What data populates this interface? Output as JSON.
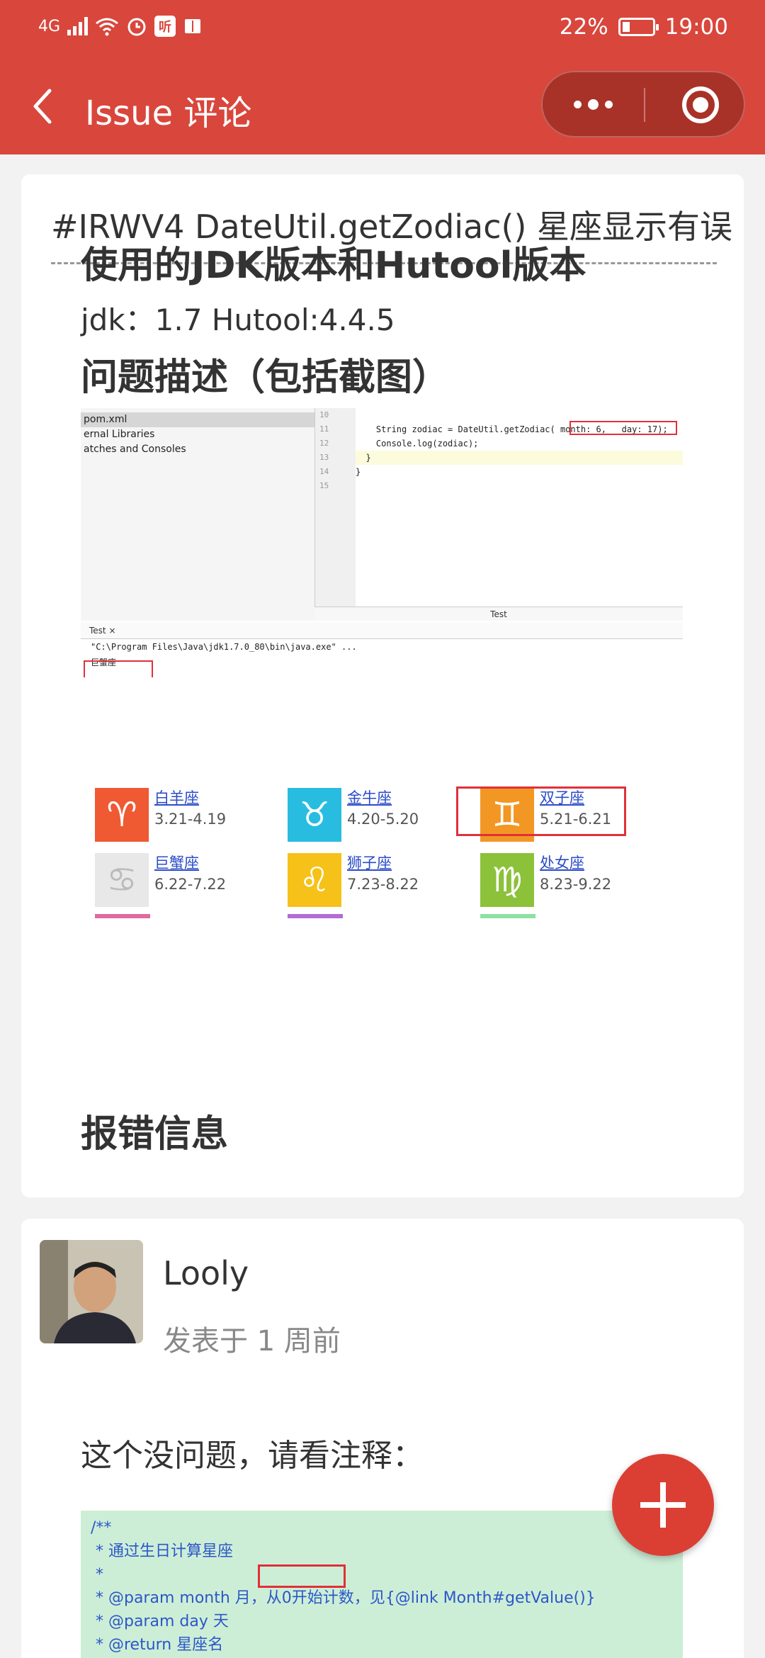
{
  "statusbar": {
    "network": "4G",
    "app_badge": "听",
    "battery": "22%",
    "time": "19:00"
  },
  "nav": {
    "title": "Issue 评论"
  },
  "issue": {
    "title": "#IRWV4 DateUtil.getZodiac() 星座显示有误",
    "sections": [
      {
        "heading": "使用的JDK版本和Hutool版本",
        "text": "jdk：1.7 Hutool:4.4.5"
      },
      {
        "heading": "问题描述（包括截图）"
      },
      {
        "heading": "报错信息"
      }
    ],
    "ide": {
      "tree": [
        "pom.xml",
        "ernal Libraries",
        "atches and Consoles"
      ],
      "line_numbers": [
        "10",
        "11",
        "12",
        "13",
        "14",
        "15"
      ],
      "code": [
        "",
        "    String zodiac = DateUtil.getZodiac( month: 6,   day: 17);",
        "    Console.log(zodiac);",
        "  }",
        "}",
        ""
      ],
      "bottom_tab": "Test",
      "console_tab": "Test ×",
      "console": [
        "\"C:\\Program Files\\Java\\jdk1.7.0_80\\bin\\java.exe\" ...",
        "巨蟹座"
      ]
    },
    "zodiac": [
      {
        "name": "白羊座",
        "dates": "3.21-4.19",
        "symbol": "♈",
        "color": "#ef5a33"
      },
      {
        "name": "金牛座",
        "dates": "4.20-5.20",
        "symbol": "♉",
        "color": "#28bde0"
      },
      {
        "name": "双子座",
        "dates": "5.21-6.21",
        "symbol": "♊",
        "color": "#f29724"
      },
      {
        "name": "巨蟹座",
        "dates": "6.22-7.22",
        "symbol": "♋",
        "color": "#e8e8e8"
      },
      {
        "name": "狮子座",
        "dates": "7.23-8.22",
        "symbol": "♌",
        "color": "#f6c219"
      },
      {
        "name": "处女座",
        "dates": "8.23-9.22",
        "symbol": "♍",
        "color": "#8cc13a"
      }
    ]
  },
  "comment": {
    "author": "Looly",
    "posted": "发表于 1 周前",
    "text": "这个没问题，请看注释：",
    "code": [
      "/**",
      " * 通过生日计算星座",
      " *",
      " * @param month 月，从0开始计数，见{@link Month#getValue()}",
      " * @param day 天",
      " * @return 星座名",
      " */"
    ]
  },
  "colors": {
    "header": "#d9463c",
    "fab": "#db3f34",
    "highlight_box": "#e0303a"
  }
}
